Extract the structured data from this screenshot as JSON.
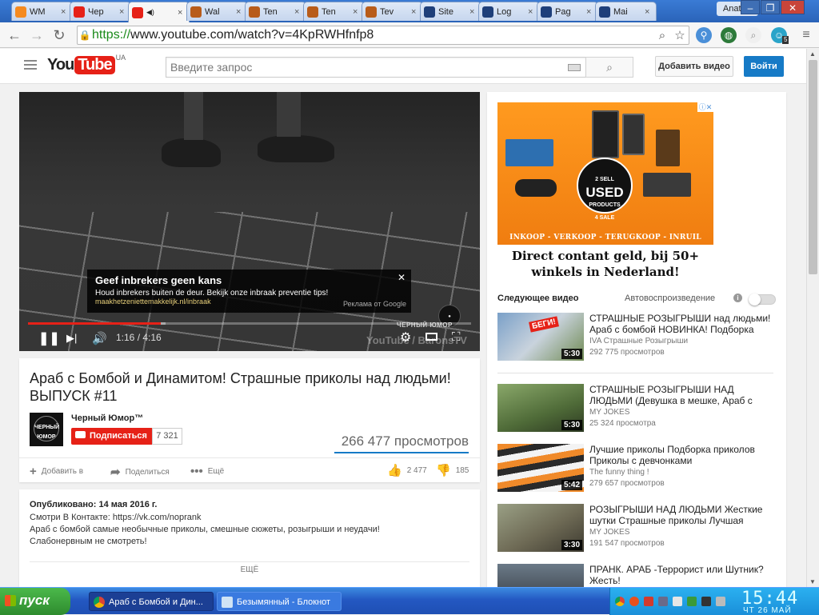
{
  "browser": {
    "tabs": [
      {
        "label": "WM",
        "color": "#f58a1f"
      },
      {
        "label": "Чер",
        "color": "#e62117"
      },
      {
        "label": "",
        "color": "#e62117",
        "active": true
      },
      {
        "label": "Wal",
        "color": "#b85c1a"
      },
      {
        "label": "Ten",
        "color": "#b85c1a"
      },
      {
        "label": "Ten",
        "color": "#b85c1a"
      },
      {
        "label": "Tev",
        "color": "#b85c1a"
      },
      {
        "label": "Site",
        "color": "#1e3f7a"
      },
      {
        "label": "Log",
        "color": "#1e3f7a"
      },
      {
        "label": "Pag",
        "color": "#1e3f7a"
      },
      {
        "label": "Mai",
        "color": "#1e3f7a"
      }
    ],
    "profile": "Anatolij",
    "url_scheme": "https://",
    "url_rest": "www.youtube.com/watch?v=4KpRWHfnfp8",
    "extension_badge": "5"
  },
  "youtube": {
    "logo_you": "You",
    "logo_tube": "Tube",
    "logo_region": "UA",
    "search_placeholder": "Введите запрос",
    "upload_label": "Добавить видео",
    "signin_label": "Войти"
  },
  "player": {
    "ad_title": "Geef inbrekers geen kans",
    "ad_text": "Houd inbrekers buiten de deur. Bekijk onze inbraak preventie tips!",
    "ad_url": "maakhetzeniettemakkelijk.nl/inbraak",
    "ad_by": "Реклама от Google",
    "channel_bug": "ЧЕРНЫЙ ЮМОР",
    "watermark": "YouTube / BaronsTV",
    "current_time": "1:16",
    "duration": "4:16",
    "time_display": "1:16 / 4:16",
    "progress_fraction": 0.3,
    "buffered_fraction": 0.31
  },
  "video": {
    "title": "Араб с Бомбой и Динамитом! Страшные приколы над людьми! ВЫПУСК #11",
    "channel": "Черный Юмор™",
    "avatar_text": "ЧЕРНЫЙ ЮМОР",
    "subscribe_label": "Подписаться",
    "subscriber_count": "7 321",
    "views": "266 477 просмотров",
    "add_to": "Добавить в",
    "share": "Поделиться",
    "more": "Ещё",
    "likes": "2 477",
    "dislikes": "185"
  },
  "description": {
    "published": "Опубликовано: 14 мая 2016 г.",
    "line1": "Смотри В Контакте: https://vk.com/noprank",
    "line2": "Араб с бомбой самые необычные приколы, смешные сюжеты, розыгрыши и неудачи!",
    "line3": "Слабонервным не смотреть!",
    "show_more": "ЕЩЁ"
  },
  "banner": {
    "badge_top": "2 SELL",
    "badge_main": "USED",
    "badge_sub": "PRODUCTS",
    "badge_bottom": "4 SALE",
    "strip": "INKOOP - VERKOOP - TERUGKOOP - INRUIL",
    "line1": "Direct contant geld, bij 50+",
    "line2": "winkels in Nederland!"
  },
  "sidebar": {
    "next_label": "Следующее видео",
    "autoplay_label": "Автовоспроизведение",
    "autoplay_on": false,
    "items": [
      {
        "title": "СТРАШНЫЕ РОЗЫГРЫШИ над людьми! Араб с бомбой НОВИНКА! Подборка",
        "channel": "IVA Страшные Розыгрыши",
        "views": "292 775 просмотров",
        "duration": "5:30"
      },
      {
        "title": "СТРАШНЫЕ РОЗЫГРЫШИ НАД ЛЮДЬМИ (Девушка в мешке, Араб с",
        "channel": "MY JOKES",
        "views": "25 324 просмотра",
        "duration": "5:30"
      },
      {
        "title": "Лучшие приколы Подборка приколов Приколы с девчонками",
        "channel": "The funny thing !",
        "views": "279 657 просмотров",
        "duration": "5:42"
      },
      {
        "title": "РОЗЫГРЫШИ НАД ЛЮДЬМИ Жесткие шутки Страшные приколы Лучшая",
        "channel": "MY JOKES",
        "views": "191 547 просмотров",
        "duration": "3:30"
      },
      {
        "title": "ПРАНК. АРАБ -Террорист или Шутник? Жесть!",
        "channel": "",
        "views": "",
        "duration": ""
      }
    ]
  },
  "taskbar": {
    "start_label": "пуск",
    "tasks": [
      {
        "label": "Араб с Бомбой и Дин...",
        "active": true
      },
      {
        "label": "Безымянный - Блокнот",
        "active": false
      }
    ],
    "clock": "15:44",
    "date": "ЧТ 26 МАЙ"
  }
}
